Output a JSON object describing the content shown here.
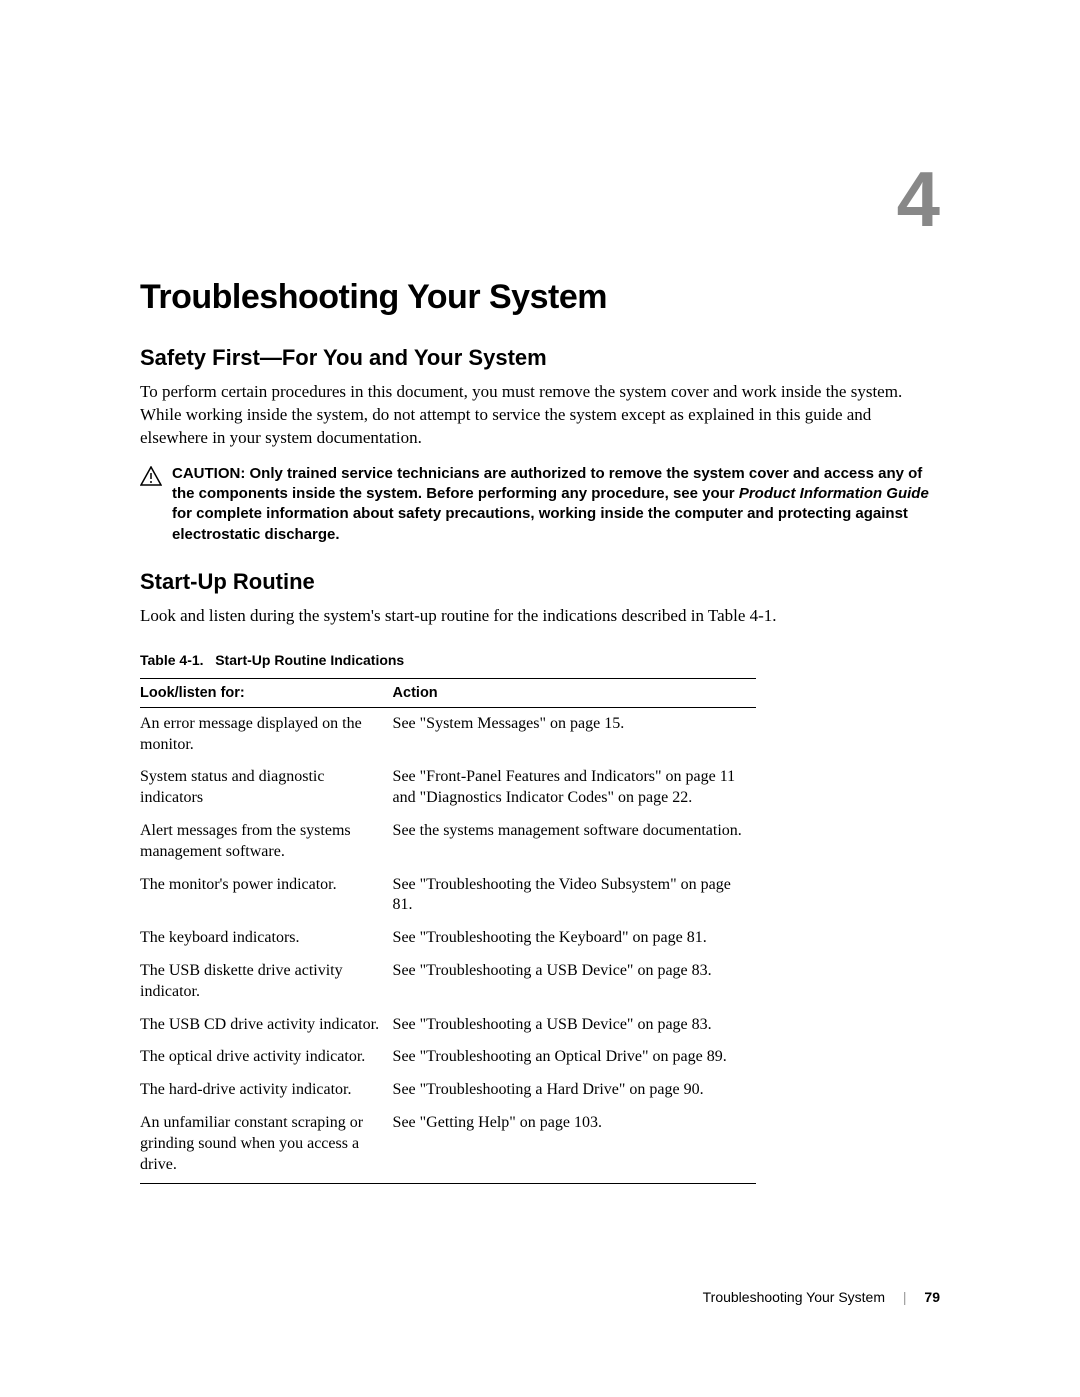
{
  "chapter": {
    "number": "4",
    "title": "Troubleshooting Your System"
  },
  "section1": {
    "title": "Safety First—For You and Your System",
    "body": "To perform certain procedures in this document, you must remove the system cover and work inside the system. While working inside the system, do not attempt to service the system except as explained in this guide and elsewhere in your system documentation."
  },
  "caution": {
    "label": "CAUTION: ",
    "text_before": "Only trained service technicians are authorized to remove the system cover and access any of the components inside the system. Before performing any procedure, see your ",
    "italic": "Product Information Guide",
    "text_after": " for complete information about safety precautions, working inside the computer and protecting against electrostatic discharge."
  },
  "section2": {
    "title": "Start-Up Routine",
    "body": "Look and listen during the system's start-up routine for the indications described in Table 4-1."
  },
  "table": {
    "caption_label": "Table 4-1.",
    "caption_title": "Start-Up Routine Indications",
    "headers": {
      "col1": "Look/listen for:",
      "col2": "Action"
    },
    "rows": [
      {
        "look": "An error message displayed on the monitor.",
        "action": "See \"System Messages\" on page 15."
      },
      {
        "look": "System status and diagnostic indicators",
        "action": "See \"Front-Panel Features and Indicators\" on page 11 and \"Diagnostics Indicator Codes\" on page 22."
      },
      {
        "look": "Alert messages from the systems management software.",
        "action": "See the systems management software documentation."
      },
      {
        "look": "The monitor's power indicator.",
        "action": "See \"Troubleshooting the Video Subsystem\" on page 81."
      },
      {
        "look": "The keyboard indicators.",
        "action": "See \"Troubleshooting the Keyboard\" on page 81."
      },
      {
        "look": "The USB diskette drive activity indicator.",
        "action": "See \"Troubleshooting a USB Device\" on page 83."
      },
      {
        "look": "The USB CD drive activity indicator.",
        "action": "See \"Troubleshooting a USB Device\" on page 83."
      },
      {
        "look": "The optical drive activity indicator.",
        "action": "See \"Troubleshooting an Optical Drive\" on page 89."
      },
      {
        "look": "The hard-drive activity indicator.",
        "action": "See \"Troubleshooting a Hard Drive\" on page 90."
      },
      {
        "look": "An unfamiliar constant scraping or grinding sound when you access a drive.",
        "action": "See \"Getting Help\" on page 103."
      }
    ]
  },
  "footer": {
    "section": "Troubleshooting Your System",
    "page": "79"
  }
}
